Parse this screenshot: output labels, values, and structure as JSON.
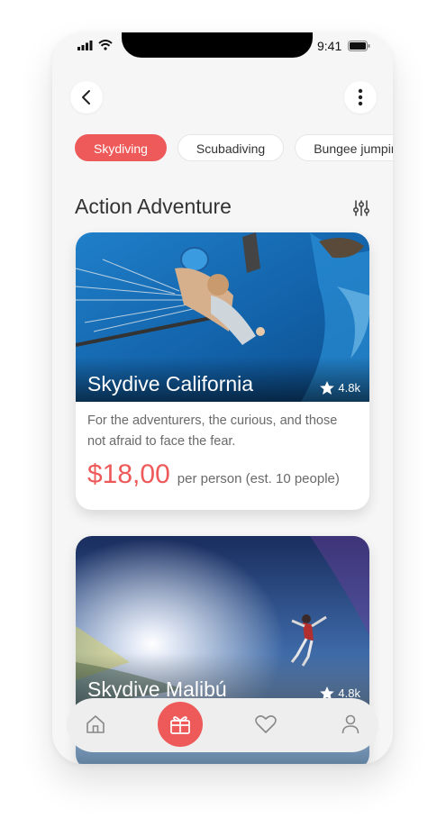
{
  "status_bar": {
    "time": "9:41"
  },
  "header": {
    "back_icon": "chevron-left-icon",
    "menu_icon": "more-vertical-icon"
  },
  "chips": [
    {
      "label": "Skydiving",
      "active": true
    },
    {
      "label": "Scubadiving",
      "active": false
    },
    {
      "label": "Bungee jumping",
      "active": false
    }
  ],
  "section": {
    "title": "Action Adventure",
    "filter_icon": "sliders-icon"
  },
  "cards": [
    {
      "title": "Skydive California",
      "rating": "4.8k",
      "description": "For the adventurers, the curious, and those not afraid to face the fear.",
      "price": "$18,00",
      "price_note": "per person (est. 10 people)"
    },
    {
      "title": "Skydive Malibú",
      "rating": "4.8k"
    }
  ],
  "tab_bar": {
    "items": [
      "home-icon",
      "gift-icon",
      "heart-icon",
      "user-icon"
    ],
    "active": "gift-icon"
  },
  "colors": {
    "accent": "#ee5a5a",
    "background": "#f6f6f6"
  }
}
